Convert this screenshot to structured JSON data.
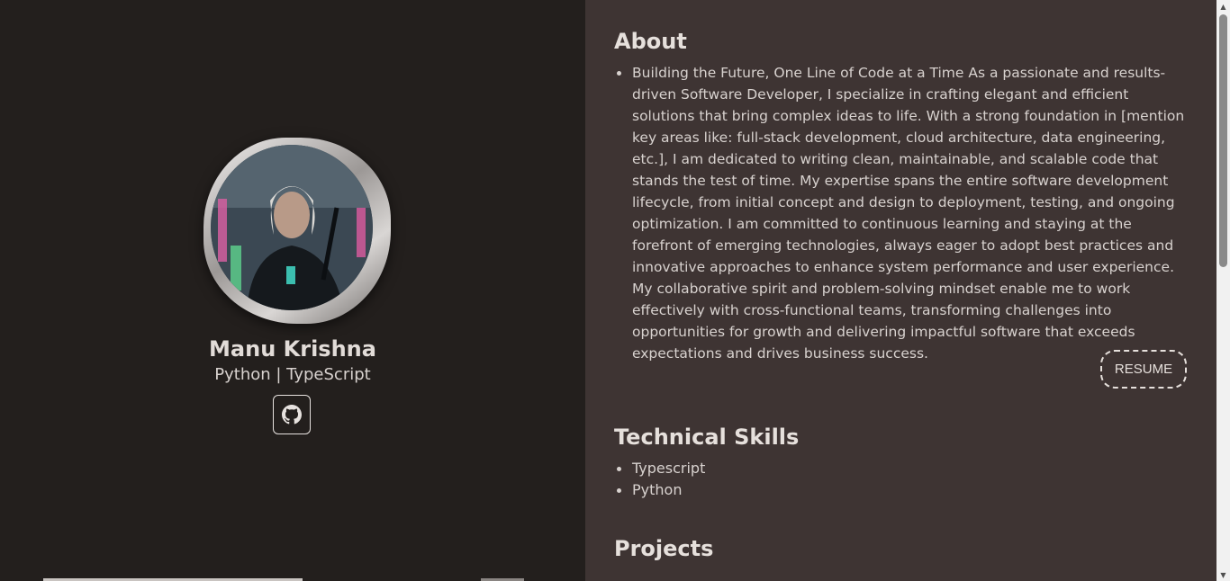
{
  "profile": {
    "name": "Manu Krishna",
    "subtitle": "Python | TypeScript"
  },
  "about": {
    "title": "About",
    "text": "Building the Future, One Line of Code at a Time As a passionate and results-driven Software Developer, I specialize in crafting elegant and efficient solutions that bring complex ideas to life. With a strong foundation in [mention key areas like: full-stack development, cloud architecture, data engineering, etc.], I am dedicated to writing clean, maintainable, and scalable code that stands the test of time. My expertise spans the entire software development lifecycle, from initial concept and design to deployment, testing, and ongoing optimization. I am committed to continuous learning and staying at the forefront of emerging technologies, always eager to adopt best practices and innovative approaches to enhance system performance and user experience. My collaborative spirit and problem-solving mindset enable me to work effectively with cross-functional teams, transforming challenges into opportunities for growth and delivering impactful software that exceeds expectations and drives business success.",
    "resume_label": "RESUME"
  },
  "skills": {
    "title": "Technical Skills",
    "items": [
      "Typescript",
      "Python"
    ]
  },
  "projects": {
    "title": "Projects"
  },
  "icons": {
    "social": "github-icon",
    "scroll_up": "arrow-up-icon",
    "scroll_down": "arrow-down-icon"
  },
  "colors": {
    "left_bg": "#231f1d",
    "right_bg": "#3e3433",
    "text": "#d8d2cf"
  }
}
